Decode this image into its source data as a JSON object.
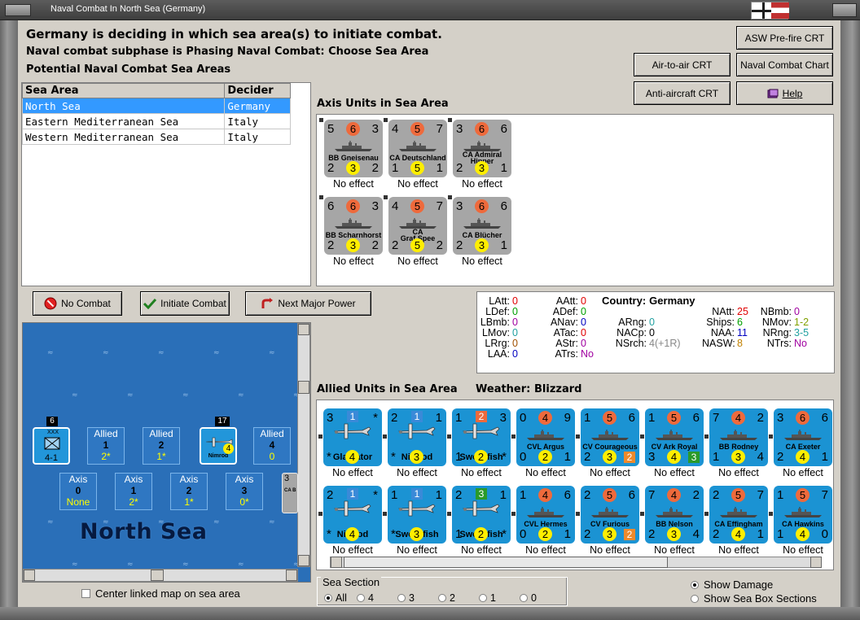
{
  "window": {
    "title": "Naval Combat In North Sea (Germany)"
  },
  "header": {
    "line1": "Germany is deciding in which sea area(s) to initiate combat.",
    "line2": "Naval combat subphase is Phasing Naval Combat: Choose Sea Area",
    "line3": "Potential Naval Combat Sea Areas"
  },
  "top_buttons": {
    "asw": "ASW Pre-fire CRT",
    "air": "Air-to-air CRT",
    "naval": "Naval Combat Chart",
    "aa": "Anti-aircraft CRT",
    "help": "Help"
  },
  "sea_table": {
    "columns": [
      "Sea Area",
      "Decider"
    ],
    "rows": [
      [
        "North Sea",
        "Germany"
      ],
      [
        "Eastern Mediterranean Sea",
        "Italy"
      ],
      [
        "Western Mediterranean Sea",
        "Italy"
      ]
    ],
    "selected": 0
  },
  "axis": {
    "title": "Axis Units in Sea Area",
    "units": [
      {
        "tl": "5",
        "tc": "6",
        "tr": "3",
        "name": "BB Gneisenau",
        "name2": "",
        "bl": "2",
        "bc": "3",
        "br": "2",
        "effect": "No effect"
      },
      {
        "tl": "4",
        "tc": "5",
        "tr": "7",
        "name": "CA Deutschland",
        "name2": "",
        "bl": "1",
        "bc": "5",
        "br": "1",
        "effect": "No effect"
      },
      {
        "tl": "3",
        "tc": "6",
        "tr": "6",
        "name": "CA Admiral",
        "name2": "Hipper",
        "bl": "2",
        "bc": "3",
        "br": "1",
        "effect": "No effect"
      },
      {
        "tl": "6",
        "tc": "6",
        "tr": "3",
        "name": "BB Scharnhorst",
        "name2": "",
        "bl": "2",
        "bc": "3",
        "br": "2",
        "effect": "No effect"
      },
      {
        "tl": "4",
        "tc": "5",
        "tr": "7",
        "name": "CA",
        "name2": "Graf Spee",
        "bl": "2",
        "bc": "5",
        "br": "2",
        "effect": "No effect"
      },
      {
        "tl": "3",
        "tc": "6",
        "tr": "6",
        "name": "CA Blücher",
        "name2": "",
        "bl": "2",
        "bc": "3",
        "br": "1",
        "effect": "No effect"
      }
    ]
  },
  "actions": {
    "no_combat": "No Combat",
    "initiate": "Initiate Combat",
    "next": "Next Major Power"
  },
  "stats": {
    "country_label": "Country:",
    "country": "Germany",
    "col1": [
      [
        "LAtt:",
        "0",
        "#e00000"
      ],
      [
        "LDef:",
        "0",
        "#00a000"
      ],
      [
        "LBmb:",
        "0",
        "#a000a0"
      ],
      [
        "LMov:",
        "0",
        "#20a0a0"
      ],
      [
        "LRrg:",
        "0",
        "#a05000"
      ],
      [
        "LAA:",
        "0",
        "#0000c0"
      ]
    ],
    "col2": [
      [
        "AAtt:",
        "0",
        "#e00000"
      ],
      [
        "ADef:",
        "0",
        "#00a000"
      ],
      [
        "ANav:",
        "0",
        "#0000c0"
      ],
      [
        "ATac:",
        "0",
        "#e00000"
      ],
      [
        "AStr:",
        "0",
        "#a000a0"
      ],
      [
        "ATrs:",
        "No",
        "#a000a0"
      ]
    ],
    "col3": [
      [
        "ARng:",
        "0",
        "#20a0a0"
      ],
      [
        "NACp:",
        "0",
        "#000"
      ],
      [
        "NSrch:",
        "4(+1R)",
        "#888"
      ]
    ],
    "col4": [
      [
        "NAtt:",
        "25",
        "#e00000"
      ],
      [
        "Ships:",
        "6",
        "#00a000"
      ],
      [
        "NAA:",
        "11",
        "#0000c0"
      ],
      [
        "NASW:",
        "8",
        "#c08000"
      ]
    ],
    "col5": [
      [
        "NBmb:",
        "0",
        "#a000a0"
      ],
      [
        "NMov:",
        "1-2",
        "#80a000"
      ],
      [
        "NRng:",
        "3-5",
        "#20a0a0"
      ],
      [
        "NTrs:",
        "No",
        "#a000a0"
      ]
    ]
  },
  "map": {
    "sea_name": "North Sea",
    "hq": {
      "stack": "6",
      "xxx": "XXX",
      "label": "4-1"
    },
    "plane_stack": "17",
    "plane_name": "Nimrod",
    "plane_val": "4",
    "allied_boxes": [
      {
        "t": "Allied",
        "n": "1",
        "v": "2*"
      },
      {
        "t": "Allied",
        "n": "2",
        "v": "1*"
      },
      {
        "t": "Allied",
        "n": "4",
        "v": "0"
      }
    ],
    "axis_boxes": [
      {
        "t": "Axis",
        "n": "0",
        "v": "None"
      },
      {
        "t": "Axis",
        "n": "1",
        "v": "2*"
      },
      {
        "t": "Axis",
        "n": "2",
        "v": "1*"
      },
      {
        "t": "Axis",
        "n": "3",
        "v": "0*"
      }
    ],
    "edge_counter": {
      "a": "3",
      "b": "CA B"
    },
    "center_label": "Center linked map on sea area"
  },
  "allied": {
    "title": "Allied Units in Sea Area",
    "weather_label": "Weather:",
    "weather": "Blizzard",
    "row1": [
      {
        "kind": "air",
        "tl": "3",
        "tc": "1",
        "tr": "*",
        "name": "Gladiator",
        "bl": "*",
        "bc": "4",
        "br": "",
        "effect": "No effect"
      },
      {
        "kind": "air",
        "tl": "2",
        "tc": "1",
        "tr": "1",
        "name": "Nimrod",
        "bl": "*",
        "bc": "3",
        "br": "",
        "effect": "No effect"
      },
      {
        "kind": "air",
        "tl": "1",
        "tc": "2",
        "tr": "3",
        "name": "Swordfish",
        "bl": "1",
        "bc": "2",
        "br": "*",
        "effect": "No effect"
      },
      {
        "kind": "ship",
        "tl": "0",
        "tc": "4",
        "tr": "9",
        "name": "CVL Argus",
        "bl": "0",
        "bc": "2",
        "br": "1",
        "effect": "No effect"
      },
      {
        "kind": "ship",
        "tl": "1",
        "tc": "5",
        "tr": "6",
        "name": "CV Courageous",
        "bl": "2",
        "bc": "3",
        "br": "2",
        "effect": "No effect"
      },
      {
        "kind": "ship",
        "tl": "1",
        "tc": "5",
        "tr": "6",
        "name": "CV Ark Royal",
        "bl": "3",
        "bc": "4",
        "br": "3",
        "effect": "No effect"
      },
      {
        "kind": "ship",
        "tl": "7",
        "tc": "4",
        "tr": "2",
        "name": "BB Rodney",
        "bl": "1",
        "bc": "3",
        "br": "4",
        "effect": "No effect"
      },
      {
        "kind": "ship",
        "tl": "3",
        "tc": "6",
        "tr": "6",
        "name": "CA Exeter",
        "bl": "2",
        "bc": "4",
        "br": "1",
        "effect": "No effect"
      }
    ],
    "row2": [
      {
        "kind": "air",
        "tl": "2",
        "tc": "1",
        "tr": "*",
        "name": "Nimrod",
        "bl": "*",
        "bc": "4",
        "br": "",
        "effect": "No effect"
      },
      {
        "kind": "air",
        "tl": "1",
        "tc": "1",
        "tr": "1",
        "name": "Swordfish",
        "bl": "*",
        "bc": "3",
        "br": "",
        "effect": "No effect"
      },
      {
        "kind": "air",
        "tl": "2",
        "tc": "3",
        "tr": "1",
        "name": "Swordfish",
        "bl": "1",
        "bc": "2",
        "br": "*",
        "effect": "No effect"
      },
      {
        "kind": "ship",
        "tl": "1",
        "tc": "4",
        "tr": "6",
        "name": "CVL Hermes",
        "bl": "0",
        "bc": "2",
        "br": "1",
        "effect": "No effect"
      },
      {
        "kind": "ship",
        "tl": "2",
        "tc": "5",
        "tr": "6",
        "name": "CV Furious",
        "bl": "2",
        "bc": "3",
        "br": "2",
        "effect": "No effect"
      },
      {
        "kind": "ship",
        "tl": "7",
        "tc": "4",
        "tr": "2",
        "name": "BB Nelson",
        "bl": "2",
        "bc": "3",
        "br": "4",
        "effect": "No effect"
      },
      {
        "kind": "ship",
        "tl": "2",
        "tc": "5",
        "tr": "7",
        "name": "CA Effingham",
        "bl": "2",
        "bc": "4",
        "br": "1",
        "effect": "No effect"
      },
      {
        "kind": "ship",
        "tl": "1",
        "tc": "5",
        "tr": "7",
        "name": "CA Hawkins",
        "bl": "1",
        "bc": "4",
        "br": "0",
        "effect": "No effect"
      }
    ]
  },
  "sea_section": {
    "label": "Sea Section",
    "options": [
      "All",
      "4",
      "3",
      "2",
      "1",
      "0"
    ],
    "selected": "All"
  },
  "show": {
    "damage": "Show Damage",
    "boxes": "Show Sea Box Sections",
    "selected": "damage"
  }
}
